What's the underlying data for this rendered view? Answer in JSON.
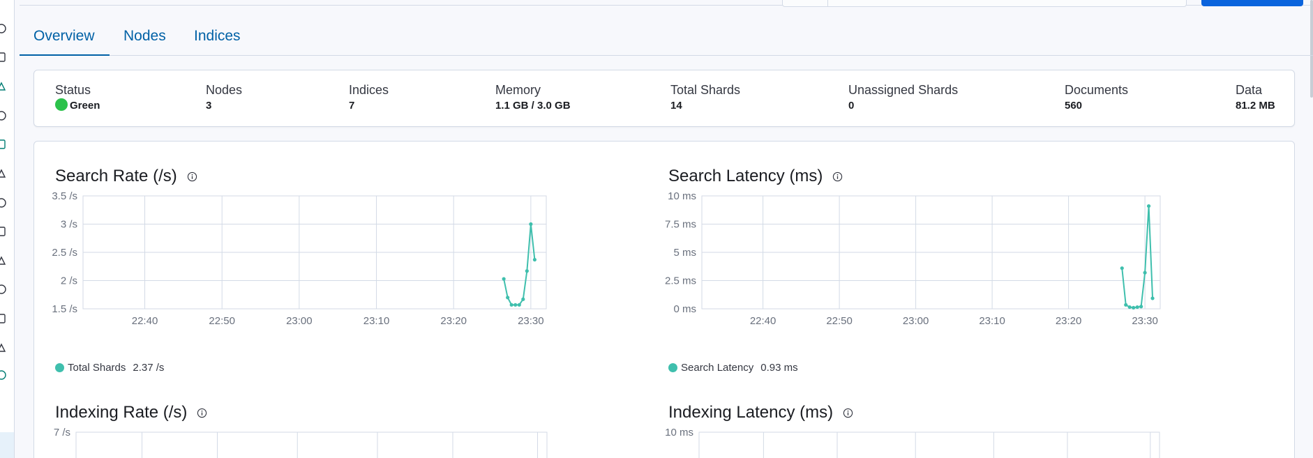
{
  "tabs": [
    {
      "label": "Overview",
      "active": true
    },
    {
      "label": "Nodes",
      "active": false
    },
    {
      "label": "Indices",
      "active": false
    }
  ],
  "status": {
    "status_label": "Status",
    "status_value": "Green",
    "status_color": "#2cc24b",
    "nodes_label": "Nodes",
    "nodes_value": "3",
    "indices_label": "Indices",
    "indices_value": "7",
    "memory_label": "Memory",
    "memory_value": "1.1 GB / 3.0 GB",
    "total_shards_label": "Total Shards",
    "total_shards_value": "14",
    "unassigned_label": "Unassigned Shards",
    "unassigned_value": "0",
    "documents_label": "Documents",
    "documents_value": "560",
    "data_label": "Data",
    "data_value": "81.2 MB"
  },
  "nav_icons": [
    "clock-icon",
    "dashboard-icon",
    "discover-icon",
    "canvas-icon",
    "maps-icon",
    "ml-icon",
    "apm-icon",
    "uptime-icon",
    "siem-icon",
    "upgrade-icon",
    "lock-icon",
    "dev-tools-icon",
    "stack-monitoring-icon"
  ],
  "accent_color": "#0061a6",
  "series_color": "#3fbfad",
  "chart_data": [
    {
      "id": "search_rate",
      "type": "line",
      "title": "Search Rate (/s)",
      "y_ticks": [
        "3.5 /s",
        "3 /s",
        "2.5 /s",
        "2 /s",
        "1.5 /s"
      ],
      "ylim": [
        1.5,
        3.5
      ],
      "x_ticks": [
        "22:40",
        "22:50",
        "23:00",
        "23:10",
        "23:20",
        "23:30"
      ],
      "x_tick_minutes": [
        40,
        50,
        60,
        70,
        80,
        90
      ],
      "xlim_minutes": [
        32,
        92
      ],
      "series": [
        {
          "name": "Total Shards",
          "legend_value": "2.37 /s",
          "x_minutes": [
            86.5,
            87.0,
            87.5,
            88.0,
            88.5,
            89.0,
            89.5,
            90.0,
            90.5
          ],
          "values": [
            2.03,
            1.7,
            1.57,
            1.57,
            1.57,
            1.67,
            2.17,
            3.0,
            2.37
          ]
        }
      ]
    },
    {
      "id": "search_latency",
      "type": "line",
      "title": "Search Latency (ms)",
      "y_ticks": [
        "10 ms",
        "7.5 ms",
        "5 ms",
        "2.5 ms",
        "0 ms"
      ],
      "ylim": [
        0,
        10
      ],
      "x_ticks": [
        "22:40",
        "22:50",
        "23:00",
        "23:10",
        "23:20",
        "23:30"
      ],
      "x_tick_minutes": [
        40,
        50,
        60,
        70,
        80,
        90
      ],
      "xlim_minutes": [
        32,
        92
      ],
      "series": [
        {
          "name": "Search Latency",
          "legend_value": "0.93 ms",
          "x_minutes": [
            87.0,
            87.5,
            88.0,
            88.5,
            89.0,
            89.5,
            90.0,
            90.5,
            91.0
          ],
          "values": [
            3.6,
            0.35,
            0.15,
            0.1,
            0.15,
            0.2,
            3.2,
            9.1,
            0.93
          ]
        }
      ]
    },
    {
      "id": "indexing_rate",
      "type": "line",
      "title": "Indexing Rate (/s)",
      "y_ticks": [
        "7 /s"
      ],
      "series": []
    },
    {
      "id": "indexing_latency",
      "type": "line",
      "title": "Indexing Latency (ms)",
      "y_ticks": [
        "10 ms"
      ],
      "series": []
    }
  ]
}
